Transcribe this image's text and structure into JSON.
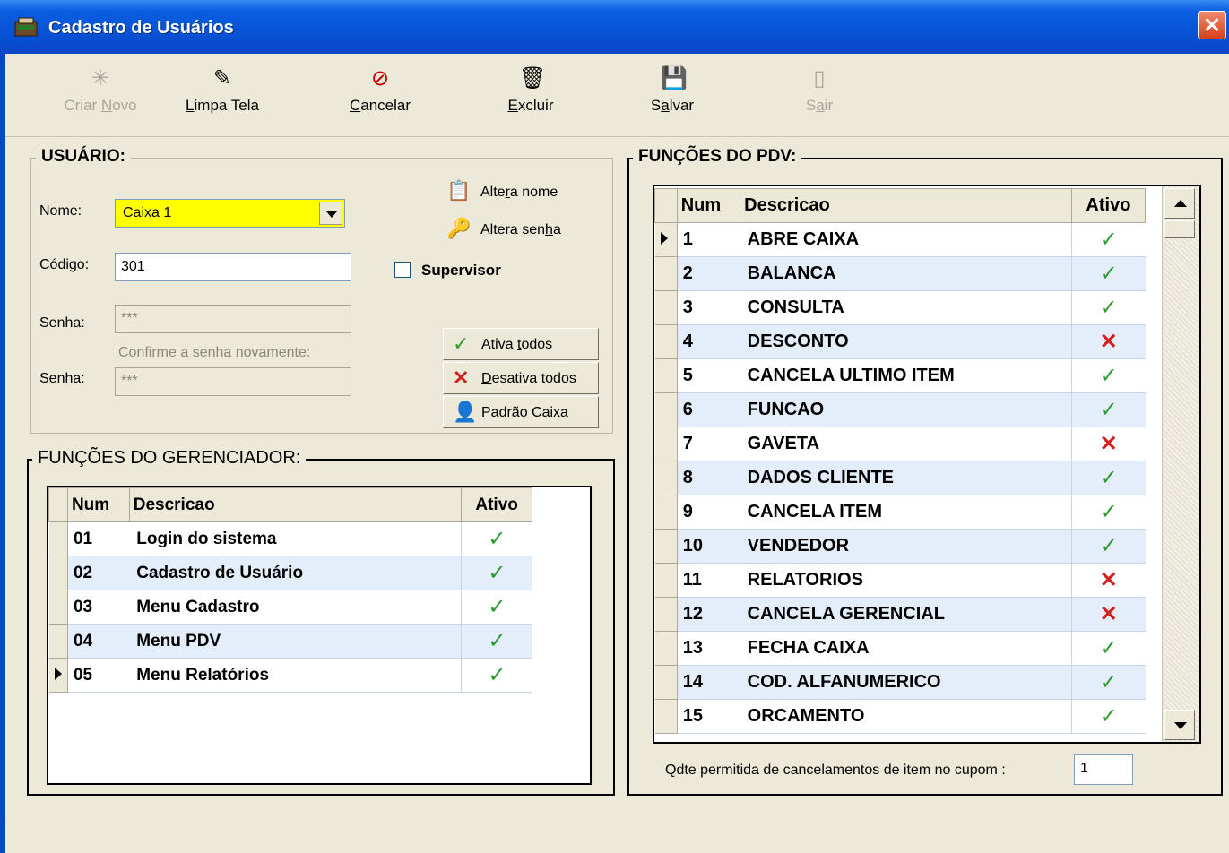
{
  "window": {
    "title": "Cadastro de Usuários"
  },
  "toolbar": {
    "criar_novo": {
      "pre": "Criar ",
      "u": "N",
      "post": "ovo"
    },
    "limpa_tela": {
      "pre": "",
      "u": "L",
      "post": "impa Tela"
    },
    "cancelar": {
      "pre": "",
      "u": "C",
      "post": "ancelar"
    },
    "excluir": {
      "pre": "",
      "u": "E",
      "post": "xcluir"
    },
    "salvar": {
      "pre": "S",
      "u": "a",
      "post": "lvar"
    },
    "sair": {
      "pre": "S",
      "u": "a",
      "post": "ir"
    }
  },
  "usuario": {
    "group_title": "USUÁRIO:",
    "nome_label": "Nome:",
    "nome_value": "Caixa 1",
    "codigo_label": "Código:",
    "codigo_value": "301",
    "senha_label": "Senha:",
    "senha_value": "***",
    "confirme_label": "Confirme a senha novamente:",
    "senha2_label": "Senha:",
    "senha2_value": "***",
    "altera_nome": {
      "pre": "Alte",
      "u": "r",
      "post": "a nome"
    },
    "altera_senha": {
      "pre": "Altera sen",
      "u": "h",
      "post": "a"
    },
    "supervisor_label": "Supervisor",
    "ativa_todos": {
      "pre": "Ativa ",
      "u": "t",
      "post": "odos"
    },
    "desativa_todos": {
      "pre": "",
      "u": "D",
      "post": "esativa todos"
    },
    "padrao_caixa": {
      "pre": "",
      "u": "P",
      "post": "adrão Caixa"
    }
  },
  "gerenciador": {
    "group_title": "FUNÇÕES DO GERENCIADOR:",
    "headers": [
      "Num",
      "Descricao",
      "Ativo"
    ],
    "rows": [
      {
        "num": "01",
        "desc": "Login do sistema",
        "ativo": true
      },
      {
        "num": "02",
        "desc": "Cadastro de Usuário",
        "ativo": true
      },
      {
        "num": "03",
        "desc": "Menu Cadastro",
        "ativo": true
      },
      {
        "num": "04",
        "desc": "Menu PDV",
        "ativo": true
      },
      {
        "num": "05",
        "desc": "Menu Relatórios",
        "ativo": true
      }
    ],
    "selected_index": 4
  },
  "pdv": {
    "group_title": "FUNÇÕES DO PDV:",
    "headers": [
      "Num",
      "Descricao",
      "Ativo"
    ],
    "rows": [
      {
        "num": "1",
        "desc": "ABRE CAIXA",
        "ativo": true
      },
      {
        "num": "2",
        "desc": "BALANCA",
        "ativo": true
      },
      {
        "num": "3",
        "desc": "CONSULTA",
        "ativo": true
      },
      {
        "num": "4",
        "desc": "DESCONTO",
        "ativo": false
      },
      {
        "num": "5",
        "desc": "CANCELA ULTIMO ITEM",
        "ativo": true
      },
      {
        "num": "6",
        "desc": "FUNCAO",
        "ativo": true
      },
      {
        "num": "7",
        "desc": "GAVETA",
        "ativo": false
      },
      {
        "num": "8",
        "desc": "DADOS CLIENTE",
        "ativo": true
      },
      {
        "num": "9",
        "desc": "CANCELA ITEM",
        "ativo": true
      },
      {
        "num": "10",
        "desc": "VENDEDOR",
        "ativo": true
      },
      {
        "num": "11",
        "desc": "RELATORIOS",
        "ativo": false
      },
      {
        "num": "12",
        "desc": "CANCELA GERENCIAL",
        "ativo": false
      },
      {
        "num": "13",
        "desc": "FECHA CAIXA",
        "ativo": true
      },
      {
        "num": "14",
        "desc": "COD. ALFANUMERICO",
        "ativo": true
      },
      {
        "num": "15",
        "desc": "ORCAMENTO",
        "ativo": true
      }
    ],
    "selected_index": 0,
    "qtde_label": "Qdte permitida de cancelamentos de item no cupom :",
    "qtde_value": "1"
  }
}
